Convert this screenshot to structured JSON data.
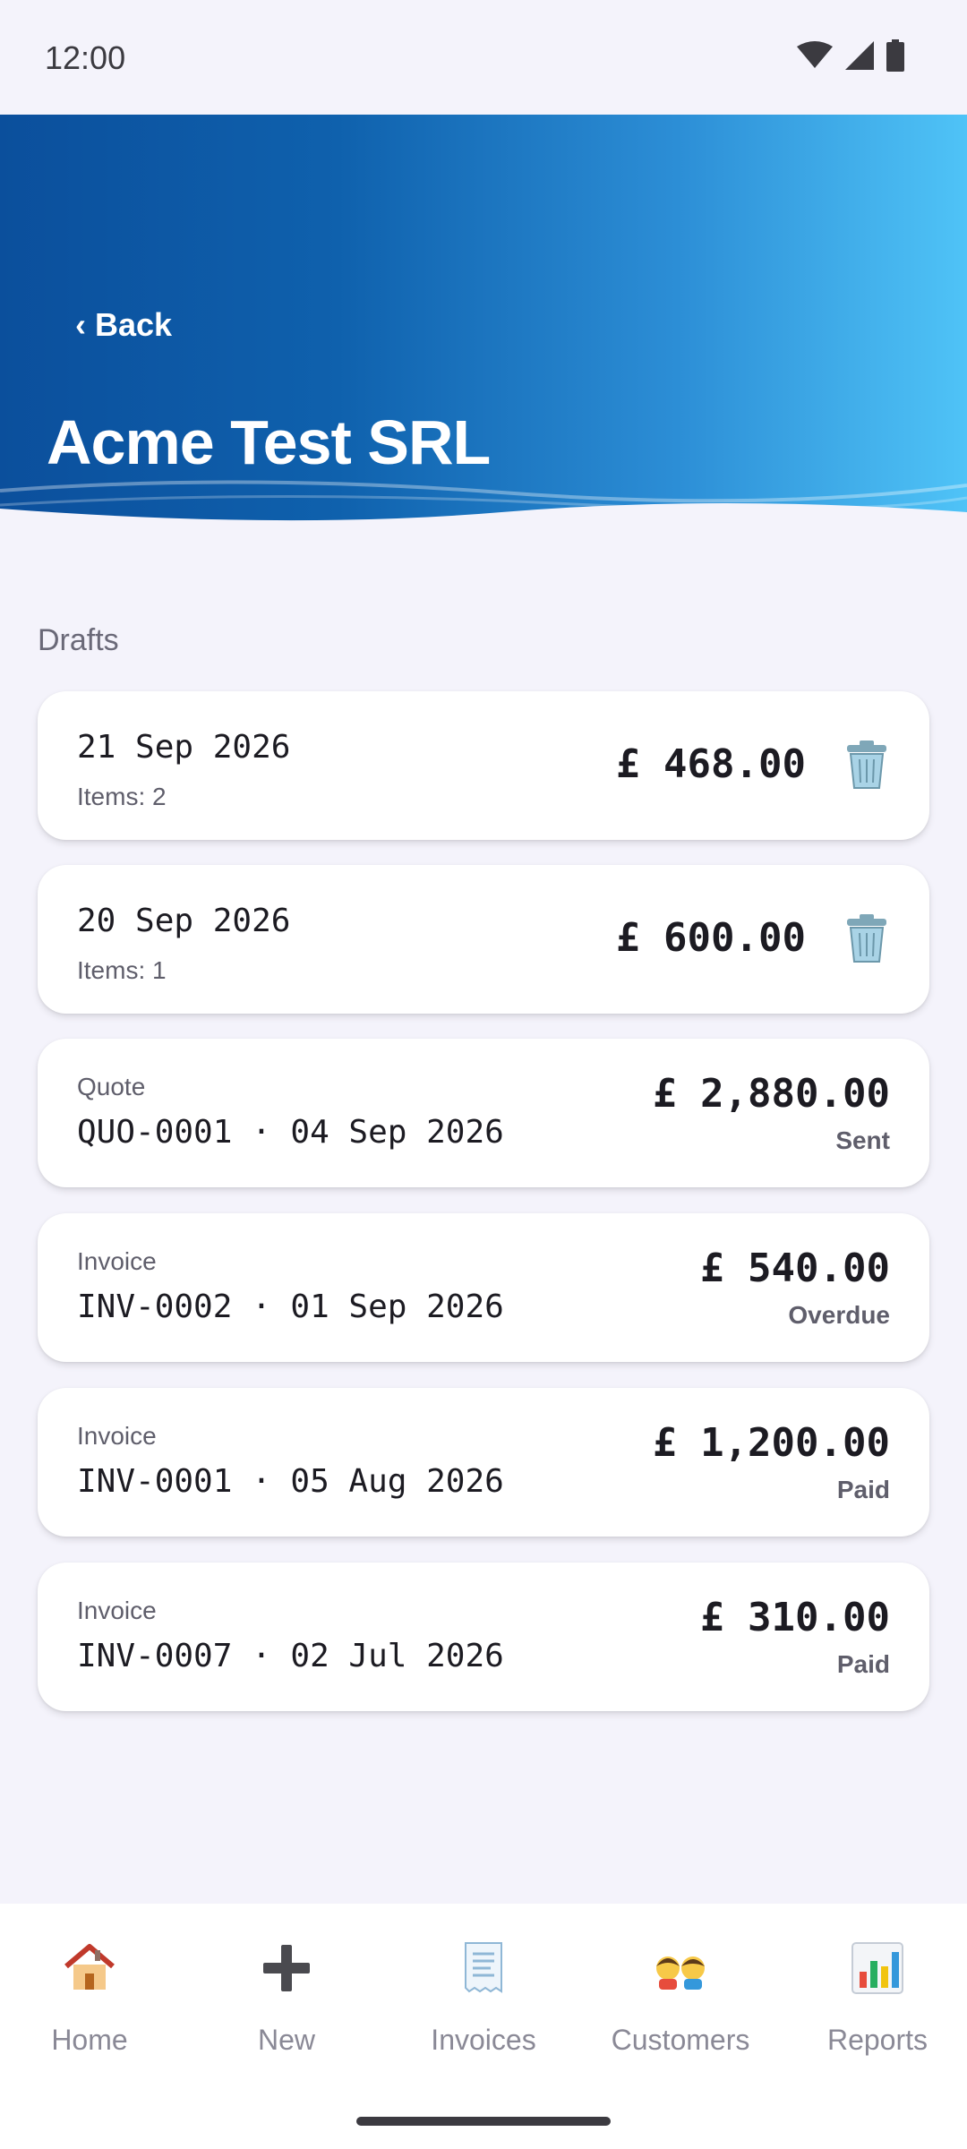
{
  "status_bar": {
    "time": "12:00"
  },
  "header": {
    "back_label": "‹ Back",
    "title": "Acme Test SRL"
  },
  "section": {
    "title": "Drafts"
  },
  "drafts": [
    {
      "date": "21 Sep 2026",
      "items": "Items: 2",
      "amount": "£ 468.00"
    },
    {
      "date": "20 Sep 2026",
      "items": "Items: 1",
      "amount": "£ 600.00"
    }
  ],
  "documents": [
    {
      "type": "Quote",
      "ref": "QUO-0001 · 04 Sep 2026",
      "amount": "£ 2,880.00",
      "status": "Sent"
    },
    {
      "type": "Invoice",
      "ref": "INV-0002 · 01 Sep 2026",
      "amount": "£ 540.00",
      "status": "Overdue"
    },
    {
      "type": "Invoice",
      "ref": "INV-0001 · 05 Aug 2026",
      "amount": "£ 1,200.00",
      "status": "Paid"
    },
    {
      "type": "Invoice",
      "ref": "INV-0007 · 02 Jul 2026",
      "amount": "£ 310.00",
      "status": "Paid"
    }
  ],
  "nav": [
    {
      "label": "Home",
      "icon": "house-icon"
    },
    {
      "label": "New",
      "icon": "plus-icon"
    },
    {
      "label": "Invoices",
      "icon": "receipt-icon"
    },
    {
      "label": "Customers",
      "icon": "people-icon"
    },
    {
      "label": "Reports",
      "icon": "bar-chart-icon"
    }
  ],
  "colors": {
    "header_start": "#0b4f9c",
    "header_end": "#4fc3f7",
    "background": "#f4f3fb"
  }
}
